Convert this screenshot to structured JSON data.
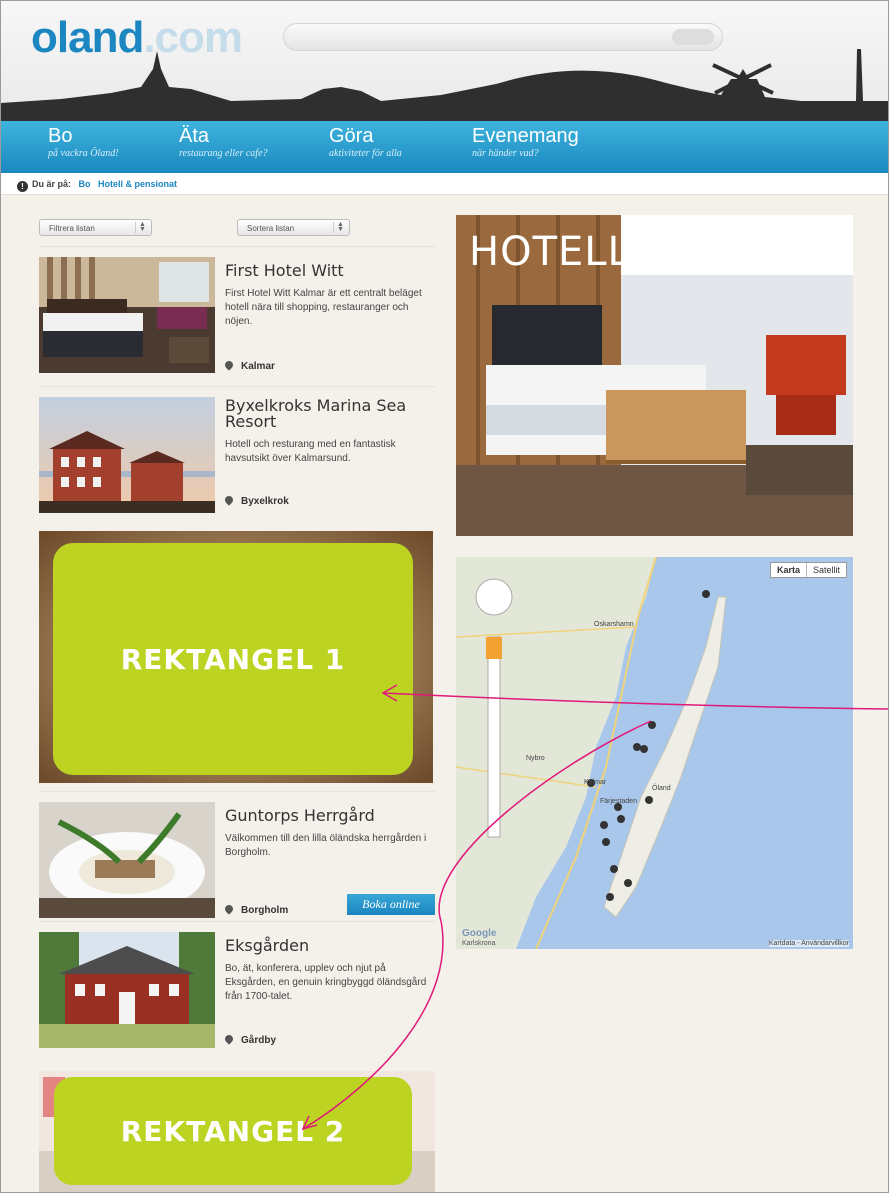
{
  "site": {
    "logo_main": "oland",
    "logo_tld": ".com"
  },
  "nav": [
    {
      "title": "Bo",
      "subtitle": "på vackra Öland!"
    },
    {
      "title": "Äta",
      "subtitle": "restaurang eller cafe?"
    },
    {
      "title": "Göra",
      "subtitle": "aktiviteter för alla"
    },
    {
      "title": "Evenemang",
      "subtitle": "när händer vad?"
    }
  ],
  "breadcrumb": {
    "prefix": "Du är på:",
    "items": [
      "Bo",
      "Hotell & pensionat"
    ]
  },
  "filters": {
    "filter_label": "Filtrera listan",
    "sort_label": "Sortera listan"
  },
  "listings": [
    {
      "title": "First Hotel Witt",
      "description": "First Hotel Witt Kalmar är ett centralt beläget hotell nära till shopping, restauranger och nöjen.",
      "location": "Kalmar"
    },
    {
      "title": "Byxelkroks Marina Sea Resort",
      "description": "Hotell och resturang med en fantastisk havsutsikt över Kalmarsund.",
      "location": "Byxelkrok"
    },
    {
      "title": "Guntorps Herrgård",
      "description": "Välkommen till den lilla öländska herrgården i Borgholm.",
      "location": "Borgholm",
      "button": "Boka online"
    },
    {
      "title": "Eksgården",
      "description": "Bo, ät, konferera, upplev och njut på Eksgården, en genuin kringbyggd öländsgård från 1700-talet.",
      "location": "Gårdby"
    }
  ],
  "ads": {
    "rect1": "REKTANGEL 1",
    "rect2": "REKTANGEL 2",
    "accent": "#bcd421",
    "arrow_color": "#e0197a"
  },
  "hero": {
    "title": "HOTELL"
  },
  "map": {
    "toggle_map": "Karta",
    "toggle_sat": "Satellit",
    "footer": "Kartdata - Användarvillkor",
    "google": "Google",
    "places": [
      "Oskarshamn",
      "Nybro",
      "Kalmar",
      "Färjestaden",
      "Öland",
      "Karlskrona"
    ]
  },
  "colors": {
    "nav": "#1a88bf",
    "link": "#1b86c0",
    "page_bg": "#f4f1ea"
  }
}
